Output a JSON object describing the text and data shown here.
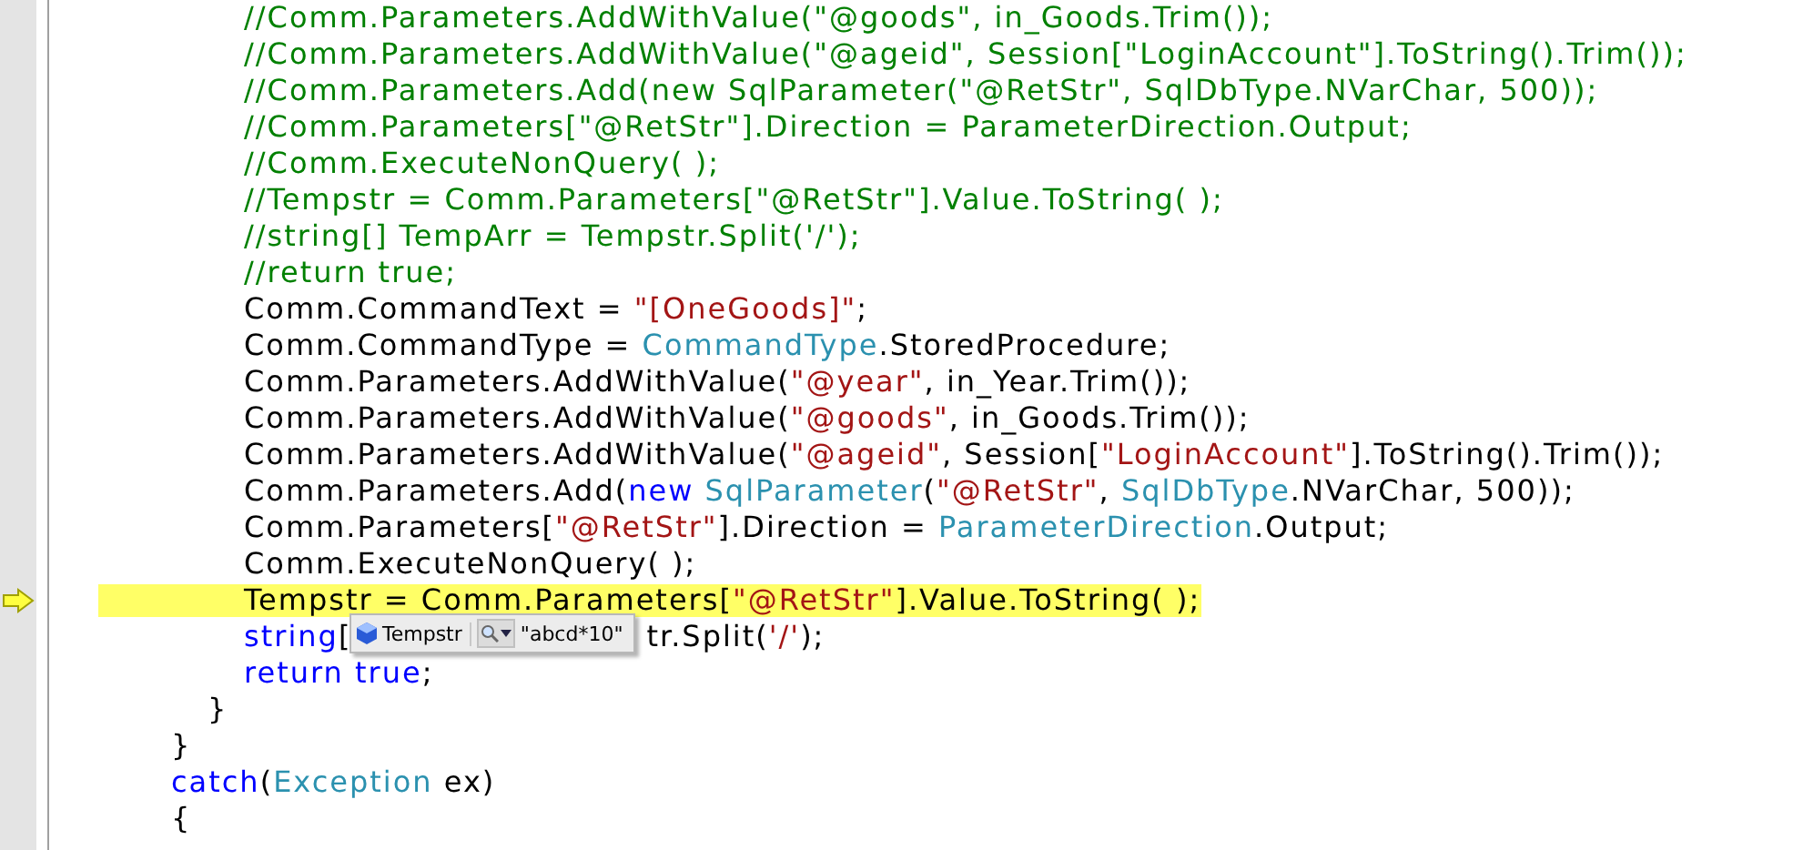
{
  "editor": {
    "lines": [
      {
        "current": false,
        "tokens": [
          {
            "kind": "comment",
            "text": "\t\t\t\t//Comm.Parameters.AddWithValue(\"@goods\", in_Goods.Trim());"
          }
        ]
      },
      {
        "current": false,
        "tokens": [
          {
            "kind": "comment",
            "text": "\t\t\t\t//Comm.Parameters.AddWithValue(\"@ageid\", Session[\"LoginAccount\"].ToString().Trim());"
          }
        ]
      },
      {
        "current": false,
        "tokens": [
          {
            "kind": "comment",
            "text": "\t\t\t\t//Comm.Parameters.Add(new SqlParameter(\"@RetStr\", SqlDbType.NVarChar, 500));"
          }
        ]
      },
      {
        "current": false,
        "tokens": [
          {
            "kind": "comment",
            "text": "\t\t\t\t//Comm.Parameters[\"@RetStr\"].Direction = ParameterDirection.Output;"
          }
        ]
      },
      {
        "current": false,
        "tokens": [
          {
            "kind": "comment",
            "text": "\t\t\t\t//Comm.ExecuteNonQuery( );"
          }
        ]
      },
      {
        "current": false,
        "tokens": [
          {
            "kind": "comment",
            "text": "\t\t\t\t//Tempstr = Comm.Parameters[\"@RetStr\"].Value.ToString( );"
          }
        ]
      },
      {
        "current": false,
        "tokens": [
          {
            "kind": "comment",
            "text": "\t\t\t\t//string[] TempArr = Tempstr.Split('/');"
          }
        ]
      },
      {
        "current": false,
        "tokens": [
          {
            "kind": "comment",
            "text": "\t\t\t\t//return true;"
          }
        ]
      },
      {
        "current": false,
        "tokens": [
          {
            "kind": "plain",
            "text": "\t\t\t\tComm.CommandText = "
          },
          {
            "kind": "string",
            "text": "\"[OneGoods]\""
          },
          {
            "kind": "plain",
            "text": ";"
          }
        ]
      },
      {
        "current": false,
        "tokens": [
          {
            "kind": "plain",
            "text": "\t\t\t\tComm.CommandType = "
          },
          {
            "kind": "type",
            "text": "CommandType"
          },
          {
            "kind": "plain",
            "text": ".StoredProcedure;"
          }
        ]
      },
      {
        "current": false,
        "tokens": [
          {
            "kind": "plain",
            "text": "\t\t\t\tComm.Parameters.AddWithValue("
          },
          {
            "kind": "string",
            "text": "\"@year\""
          },
          {
            "kind": "plain",
            "text": ", in_Year.Trim());"
          }
        ]
      },
      {
        "current": false,
        "tokens": [
          {
            "kind": "plain",
            "text": "\t\t\t\tComm.Parameters.AddWithValue("
          },
          {
            "kind": "string",
            "text": "\"@goods\""
          },
          {
            "kind": "plain",
            "text": ", in_Goods.Trim());"
          }
        ]
      },
      {
        "current": false,
        "tokens": [
          {
            "kind": "plain",
            "text": "\t\t\t\tComm.Parameters.AddWithValue("
          },
          {
            "kind": "string",
            "text": "\"@ageid\""
          },
          {
            "kind": "plain",
            "text": ", Session["
          },
          {
            "kind": "string",
            "text": "\"LoginAccount\""
          },
          {
            "kind": "plain",
            "text": "].ToString().Trim());"
          }
        ]
      },
      {
        "current": false,
        "tokens": [
          {
            "kind": "plain",
            "text": "\t\t\t\tComm.Parameters.Add("
          },
          {
            "kind": "keyword",
            "text": "new "
          },
          {
            "kind": "type",
            "text": "SqlParameter"
          },
          {
            "kind": "plain",
            "text": "("
          },
          {
            "kind": "string",
            "text": "\"@RetStr\""
          },
          {
            "kind": "plain",
            "text": ", "
          },
          {
            "kind": "type",
            "text": "SqlDbType"
          },
          {
            "kind": "plain",
            "text": ".NVarChar, 500));"
          }
        ]
      },
      {
        "current": false,
        "tokens": [
          {
            "kind": "plain",
            "text": "\t\t\t\tComm.Parameters["
          },
          {
            "kind": "string",
            "text": "\"@RetStr\""
          },
          {
            "kind": "plain",
            "text": "].Direction = "
          },
          {
            "kind": "type",
            "text": "ParameterDirection"
          },
          {
            "kind": "plain",
            "text": ".Output;"
          }
        ]
      },
      {
        "current": false,
        "tokens": [
          {
            "kind": "plain",
            "text": "\t\t\t\tComm.ExecuteNonQuery( );"
          }
        ]
      },
      {
        "current": true,
        "tokens": [
          {
            "kind": "plain",
            "text": "\t\t\t\tTempstr = Comm.Parameters["
          },
          {
            "kind": "string",
            "text": "\"@RetStr\""
          },
          {
            "kind": "plain",
            "text": "].Value.ToString( );"
          }
        ]
      },
      {
        "current": false,
        "tokens": [
          {
            "kind": "keyword",
            "text": "\t\t\t\tstring"
          },
          {
            "kind": "plain",
            "text": "["
          },
          {
            "kind": "covered"
          },
          {
            "kind": "plain",
            "text": "tr.Split("
          },
          {
            "kind": "string",
            "text": "'/'"
          },
          {
            "kind": "plain",
            "text": ");"
          }
        ]
      },
      {
        "current": false,
        "tokens": [
          {
            "kind": "keyword",
            "text": "\t\t\t\treturn true"
          },
          {
            "kind": "plain",
            "text": ";"
          }
        ]
      },
      {
        "current": false,
        "tokens": [
          {
            "kind": "plain",
            "text": "\t\t\t}"
          }
        ]
      },
      {
        "current": false,
        "tokens": [
          {
            "kind": "plain",
            "text": "\t\t}"
          }
        ]
      },
      {
        "current": false,
        "tokens": [
          {
            "kind": "keyword",
            "text": "\t\tcatch"
          },
          {
            "kind": "plain",
            "text": "("
          },
          {
            "kind": "type",
            "text": "Exception"
          },
          {
            "kind": "plain",
            "text": " ex)"
          }
        ]
      },
      {
        "current": false,
        "tokens": [
          {
            "kind": "plain",
            "text": "\t\t{"
          }
        ]
      }
    ]
  },
  "datatip": {
    "name": "Tempstr",
    "value": "\"abcd*10\""
  }
}
